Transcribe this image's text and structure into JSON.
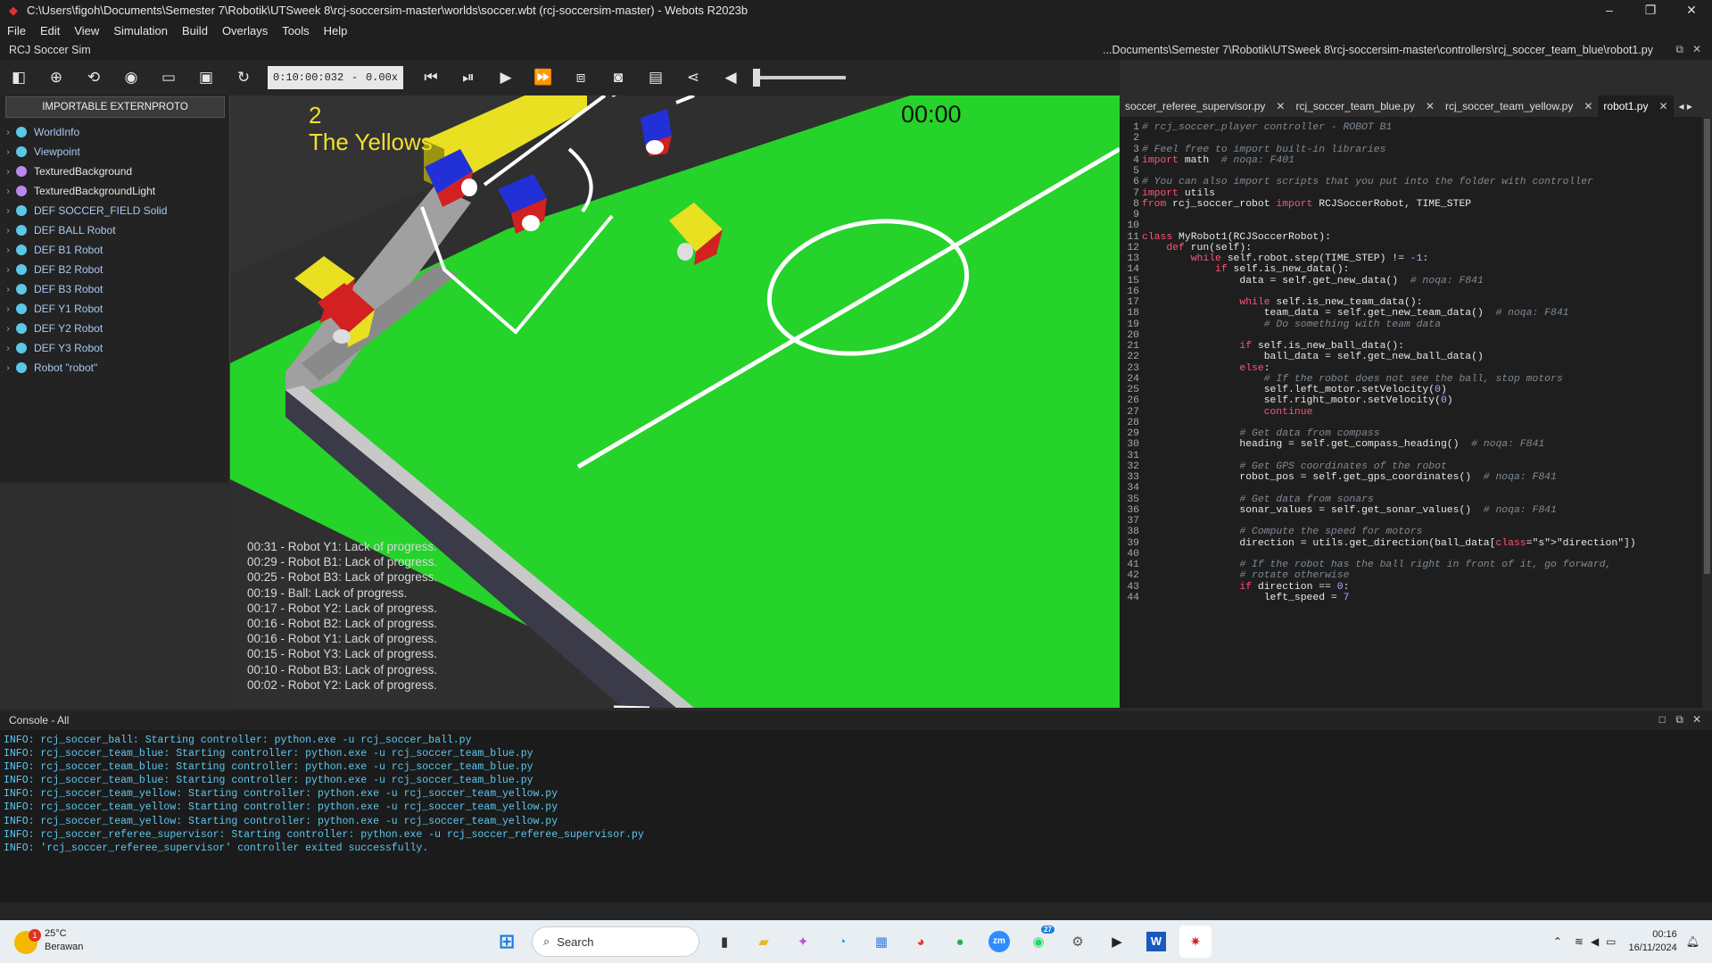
{
  "window": {
    "title": "C:\\Users\\figoh\\Documents\\Semester 7\\Robotik\\UTSweek 8\\rcj-soccersim-master\\worlds\\soccer.wbt (rcj-soccersim-master) - Webots R2023b",
    "controls": [
      "–",
      "❐",
      "✕"
    ]
  },
  "menu": [
    "File",
    "Edit",
    "View",
    "Simulation",
    "Build",
    "Overlays",
    "Tools",
    "Help"
  ],
  "scene_header": {
    "left": "RCJ Soccer Sim",
    "right": "...Documents\\Semester 7\\Robotik\\UTSweek 8\\rcj-soccersim-master\\controllers\\rcj_soccer_team_blue\\robot1.py"
  },
  "toolbar": {
    "time": "0:10:00:032",
    "separator": "-",
    "speed": "0.00x"
  },
  "scene_tree": {
    "proto_button": "IMPORTABLE EXTERNPROTO",
    "items": [
      {
        "label": "WorldInfo",
        "color": "#5bc8e8",
        "label_color": "blue"
      },
      {
        "label": "Viewpoint",
        "color": "#5bc8e8",
        "label_color": "blue"
      },
      {
        "label": "TexturedBackground",
        "color": "#b888f0",
        "label_color": "white"
      },
      {
        "label": "TexturedBackgroundLight",
        "color": "#b888f0",
        "label_color": "white"
      },
      {
        "label": "DEF SOCCER_FIELD Solid",
        "color": "#5bc8e8",
        "label_color": "blue"
      },
      {
        "label": "DEF BALL Robot",
        "color": "#5bc8e8",
        "label_color": "blue"
      },
      {
        "label": "DEF B1 Robot",
        "color": "#5bc8e8",
        "label_color": "blue"
      },
      {
        "label": "DEF B2 Robot",
        "color": "#5bc8e8",
        "label_color": "blue"
      },
      {
        "label": "DEF B3 Robot",
        "color": "#5bc8e8",
        "label_color": "blue"
      },
      {
        "label": "DEF Y1 Robot",
        "color": "#5bc8e8",
        "label_color": "blue"
      },
      {
        "label": "DEF Y2 Robot",
        "color": "#5bc8e8",
        "label_color": "blue"
      },
      {
        "label": "DEF Y3 Robot",
        "color": "#5bc8e8",
        "label_color": "blue"
      },
      {
        "label": "Robot \"robot\"",
        "color": "#5bc8e8",
        "label_color": "blue"
      }
    ]
  },
  "viewport": {
    "score": "2",
    "team": "The Yellows",
    "clock": "00:00",
    "log": [
      "00:31 - Robot Y1: Lack of progress.",
      "00:29 - Robot B1: Lack of progress.",
      "00:25 - Robot B3: Lack of progress.",
      "00:19 - Ball: Lack of progress.",
      "00:17 - Robot Y2: Lack of progress.",
      "00:16 - Robot B2: Lack of progress.",
      "00:16 - Robot Y1: Lack of progress.",
      "00:15 - Robot Y3: Lack of progress.",
      "00:10 - Robot B3: Lack of progress.",
      "00:02 - Robot Y2: Lack of progress."
    ]
  },
  "editor": {
    "tabs": [
      {
        "label": "soccer_referee_supervisor.py",
        "active": false
      },
      {
        "label": "rcj_soccer_team_blue.py",
        "active": false
      },
      {
        "label": "rcj_soccer_team_yellow.py",
        "active": false
      },
      {
        "label": "robot1.py",
        "active": true
      }
    ],
    "lines": [
      "# rcj_soccer_player controller - ROBOT B1",
      "",
      "# Feel free to import built-in libraries",
      "import math  # noqa: F401",
      "",
      "# You can also import scripts that you put into the folder with controller",
      "import utils",
      "from rcj_soccer_robot import RCJSoccerRobot, TIME_STEP",
      "",
      "",
      "class MyRobot1(RCJSoccerRobot):",
      "    def run(self):",
      "        while self.robot.step(TIME_STEP) != -1:",
      "            if self.is_new_data():",
      "                data = self.get_new_data()  # noqa: F841",
      "",
      "                while self.is_new_team_data():",
      "                    team_data = self.get_new_team_data()  # noqa: F841",
      "                    # Do something with team data",
      "",
      "                if self.is_new_ball_data():",
      "                    ball_data = self.get_new_ball_data()",
      "                else:",
      "                    # If the robot does not see the ball, stop motors",
      "                    self.left_motor.setVelocity(0)",
      "                    self.right_motor.setVelocity(0)",
      "                    continue",
      "",
      "                # Get data from compass",
      "                heading = self.get_compass_heading()  # noqa: F841",
      "",
      "                # Get GPS coordinates of the robot",
      "                robot_pos = self.get_gps_coordinates()  # noqa: F841",
      "",
      "                # Get data from sonars",
      "                sonar_values = self.get_sonar_values()  # noqa: F841",
      "",
      "                # Compute the speed for motors",
      "                direction = utils.get_direction(ball_data[\"direction\"])",
      "",
      "                # If the robot has the ball right in front of it, go forward,",
      "                # rotate otherwise",
      "                if direction == 0:",
      "                    left_speed = 7"
    ]
  },
  "console": {
    "title": "Console - All",
    "lines": [
      "INFO: rcj_soccer_ball: Starting controller: python.exe -u rcj_soccer_ball.py",
      "INFO: rcj_soccer_team_blue: Starting controller: python.exe -u rcj_soccer_team_blue.py",
      "INFO: rcj_soccer_team_blue: Starting controller: python.exe -u rcj_soccer_team_blue.py",
      "INFO: rcj_soccer_team_blue: Starting controller: python.exe -u rcj_soccer_team_blue.py",
      "INFO: rcj_soccer_team_yellow: Starting controller: python.exe -u rcj_soccer_team_yellow.py",
      "INFO: rcj_soccer_team_yellow: Starting controller: python.exe -u rcj_soccer_team_yellow.py",
      "INFO: rcj_soccer_team_yellow: Starting controller: python.exe -u rcj_soccer_team_yellow.py",
      "INFO: rcj_soccer_referee_supervisor: Starting controller: python.exe -u rcj_soccer_referee_supervisor.py",
      "INFO: 'rcj_soccer_referee_supervisor' controller exited successfully."
    ]
  },
  "taskbar": {
    "weather_temp": "25°C",
    "weather_desc": "Berawan",
    "weather_badge": "1",
    "search_placeholder": "Search",
    "whatsapp_badge": "27",
    "zoom_label": "zm",
    "word_label": "W",
    "time": "00:16",
    "date": "16/11/2024"
  }
}
